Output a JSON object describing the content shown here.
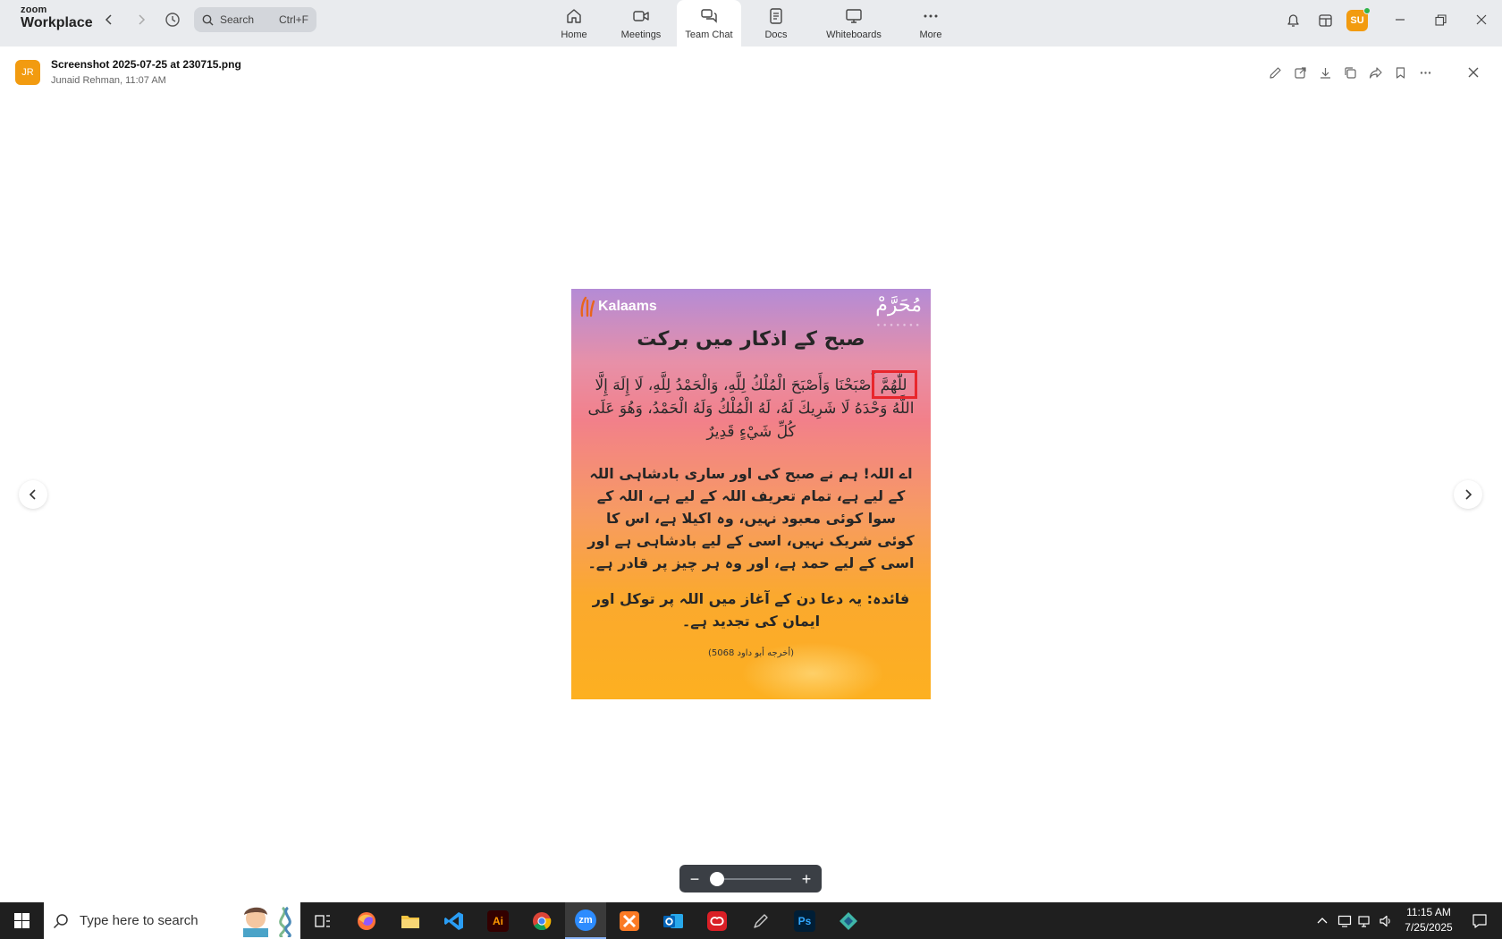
{
  "app": {
    "logo_small": "zoom",
    "logo_big": "Workplace"
  },
  "search": {
    "placeholder": "Search",
    "shortcut": "Ctrl+F"
  },
  "nav": {
    "tabs": [
      {
        "label": "Home",
        "icon": "home-icon"
      },
      {
        "label": "Meetings",
        "icon": "video-camera-icon"
      },
      {
        "label": "Team Chat",
        "icon": "chat-bubbles-icon"
      },
      {
        "label": "Docs",
        "icon": "document-icon"
      },
      {
        "label": "Whiteboards",
        "icon": "whiteboard-icon"
      },
      {
        "label": "More",
        "icon": "more-dots-icon"
      }
    ],
    "active": "Team Chat"
  },
  "user": {
    "initials": "SU",
    "status_color": "#2fb34a"
  },
  "file": {
    "sender_initials": "JR",
    "name": "Screenshot 2025-07-25 at 230715.png",
    "meta": "Junaid Rehman, 11:07 AM"
  },
  "poster": {
    "brand": "Kalaams",
    "corner_text": "مُحَرَّمْ",
    "title": "صبح کے اذکار میں برکت",
    "arabic": "للّٰهُمَّ أَصْبَحْنَا وَأَصْبَحَ الْمُلْكُ لِلَّهِ، وَالْحَمْدُ لِلَّهِ، لَا إِلَهَ إِلَّا اللَّهُ وَحْدَهُ لَا شَرِيكَ لَهُ، لَهُ الْمُلْكُ وَلَهُ الْحَمْدُ، وَهُوَ عَلَى كُلِّ شَيْءٍ قَدِيرٌ",
    "urdu": "اے اللہ! ہم نے صبح کی اور ساری بادشاہی اللہ کے لیے ہے، تمام تعریف اللہ کے لیے ہے، اللہ کے سوا کوئی معبود نہیں، وہ اکیلا ہے، اس کا کوئی شریک نہیں، اسی کے لیے بادشاہی ہے اور اسی کے لیے حمد ہے، اور وہ ہر چیز پر قادر ہے۔",
    "benefit": "فائدہ: یہ دعا دن کے آغاز میں اللہ پر توکل اور ایمان کی تجدید ہے۔",
    "reference": "(أخرجه أبو داود 5068)",
    "highlight_color": "#e8262c"
  },
  "zoom": {
    "minus": "−",
    "plus": "+",
    "level": 0.0
  },
  "taskbar": {
    "search_placeholder": "Type here to search",
    "apps": [
      {
        "name": "task-view",
        "label": ""
      },
      {
        "name": "firefox",
        "label": ""
      },
      {
        "name": "file-explorer",
        "label": ""
      },
      {
        "name": "vscode",
        "label": ""
      },
      {
        "name": "illustrator",
        "label": "Ai"
      },
      {
        "name": "chrome",
        "label": ""
      },
      {
        "name": "zoom",
        "label": "zm"
      },
      {
        "name": "xampp",
        "label": ""
      },
      {
        "name": "outlook",
        "label": ""
      },
      {
        "name": "creative-cloud",
        "label": ""
      },
      {
        "name": "pen-tool",
        "label": ""
      },
      {
        "name": "photoshop",
        "label": "Ps"
      },
      {
        "name": "app-diamond",
        "label": ""
      }
    ],
    "time": "11:15 AM",
    "date": "7/25/2025"
  }
}
